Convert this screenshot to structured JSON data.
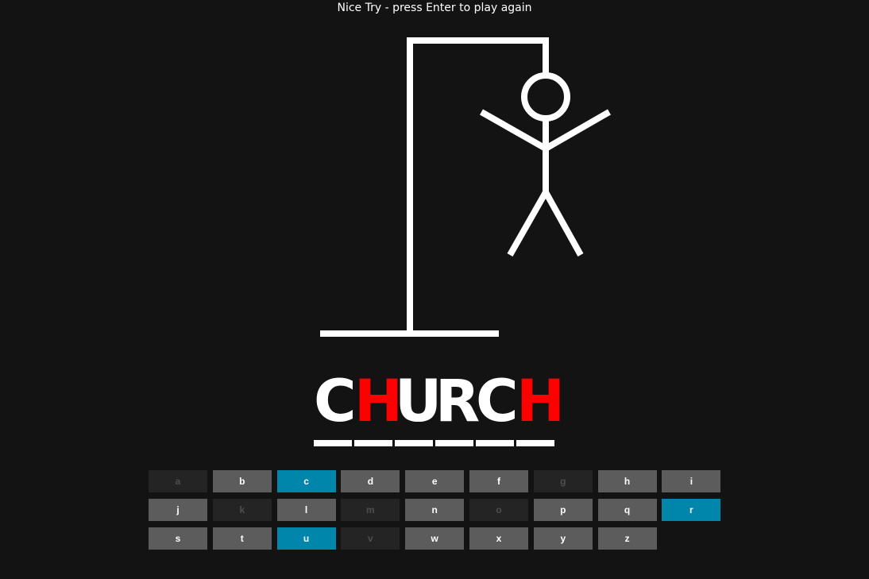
{
  "status": "Nice Try - press Enter to play again",
  "word": {
    "letters": [
      {
        "char": "C",
        "state": "guessed"
      },
      {
        "char": "H",
        "state": "missed"
      },
      {
        "char": "U",
        "state": "guessed"
      },
      {
        "char": "R",
        "state": "guessed"
      },
      {
        "char": "C",
        "state": "guessed"
      },
      {
        "char": "H",
        "state": "missed"
      }
    ]
  },
  "colors": {
    "background": "#131313",
    "missed_letter": "#ff0000",
    "correct_key": "#0086aa",
    "available_key": "#5c5c5c",
    "used_key": "#242424"
  },
  "keyboard": [
    {
      "letter": "a",
      "state": "used"
    },
    {
      "letter": "b",
      "state": "available"
    },
    {
      "letter": "c",
      "state": "correct"
    },
    {
      "letter": "d",
      "state": "available"
    },
    {
      "letter": "e",
      "state": "available"
    },
    {
      "letter": "f",
      "state": "available"
    },
    {
      "letter": "g",
      "state": "used"
    },
    {
      "letter": "h",
      "state": "available"
    },
    {
      "letter": "i",
      "state": "available"
    },
    {
      "letter": "j",
      "state": "available"
    },
    {
      "letter": "k",
      "state": "used"
    },
    {
      "letter": "l",
      "state": "available"
    },
    {
      "letter": "m",
      "state": "used"
    },
    {
      "letter": "n",
      "state": "available"
    },
    {
      "letter": "o",
      "state": "used"
    },
    {
      "letter": "p",
      "state": "available"
    },
    {
      "letter": "q",
      "state": "available"
    },
    {
      "letter": "r",
      "state": "correct"
    },
    {
      "letter": "s",
      "state": "available"
    },
    {
      "letter": "t",
      "state": "available"
    },
    {
      "letter": "u",
      "state": "correct"
    },
    {
      "letter": "v",
      "state": "used"
    },
    {
      "letter": "w",
      "state": "available"
    },
    {
      "letter": "x",
      "state": "available"
    },
    {
      "letter": "y",
      "state": "available"
    },
    {
      "letter": "z",
      "state": "available"
    }
  ]
}
